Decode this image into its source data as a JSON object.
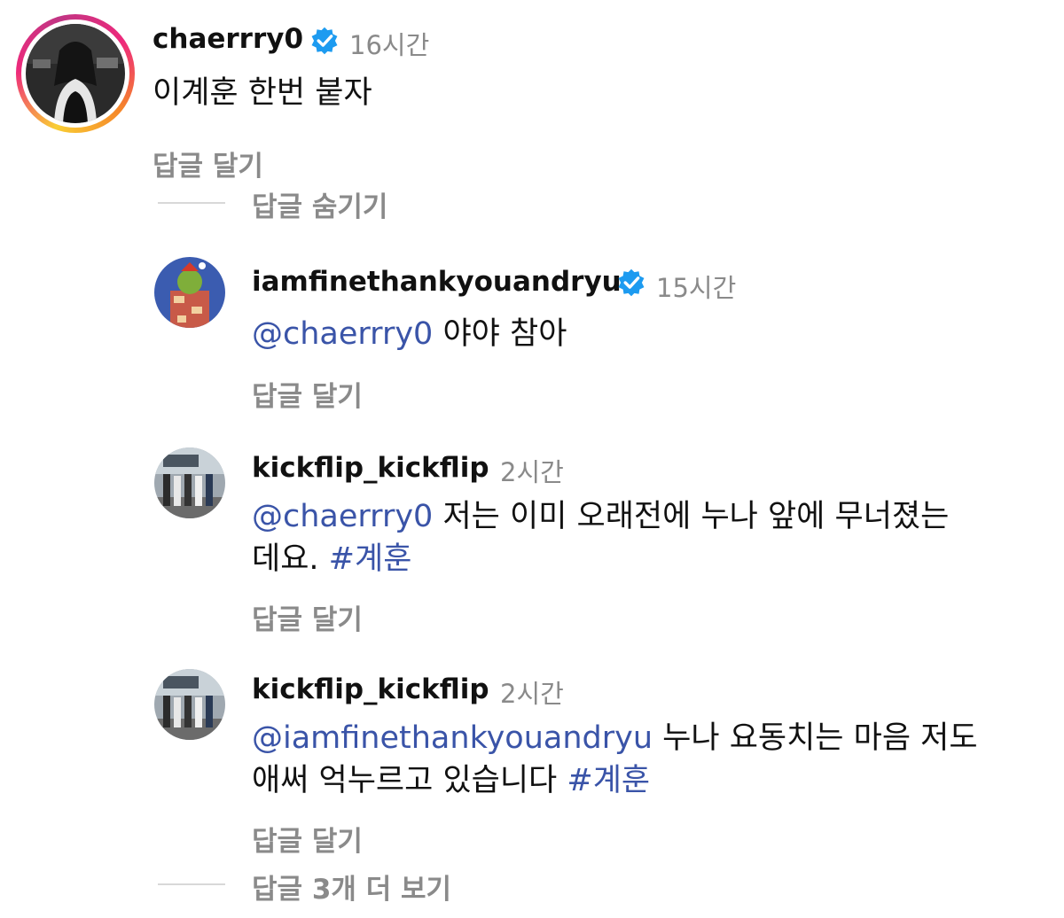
{
  "comments": {
    "main": {
      "username": "chaerrry0",
      "time": "16시간",
      "text": "이계훈 한번 붙자",
      "reply_label": "답글 달기"
    },
    "hide_replies_label": "답글 숨기기",
    "replies": [
      {
        "username": "iamfinethankyouandryu",
        "time": "15시간",
        "mention": "@chaerrry0",
        "text": "야야 참아",
        "reply_label": "답글 달기"
      },
      {
        "username": "kickflip_kickflip",
        "time": "2시간",
        "mention": "@chaerrry0",
        "text_line1": "저는 이미 오래전에 누나 앞에 무너졌는",
        "text_line2": "데요.",
        "hashtag": "#계훈",
        "reply_label": "답글 달기"
      },
      {
        "username": "kickflip_kickflip",
        "time": "2시간",
        "mention": "@iamfinethankyouandryu",
        "text_line1": "누나 요동치는 마음 저도",
        "text_line2": "애써 억누르고 있습니다",
        "hashtag": "#계훈",
        "reply_label": "답글 달기"
      }
    ],
    "view_more_label": "답글 3개 더 보기"
  },
  "colors": {
    "link": "#3a54a8",
    "muted": "#8a8a8a",
    "verified": "#1d9bf0"
  },
  "icons": {
    "verified": "verified-badge-icon"
  }
}
